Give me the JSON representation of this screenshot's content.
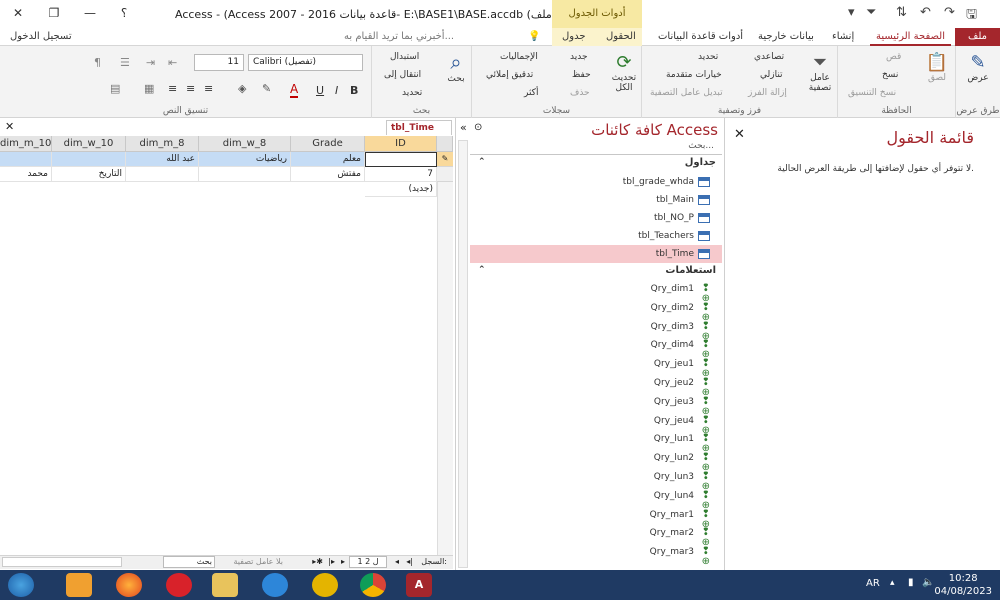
{
  "window": {
    "title": "Access - (Access 2007 - 2016 قاعدة بيانات- E:\\BASE1\\BASE.accdb (تنسيق ملف : BASE",
    "context_tools": "أدوات الجدول",
    "help": "؟",
    "min": "—",
    "restore": "❐",
    "close": "✕"
  },
  "tabs": {
    "file": "ملف",
    "home": "الصفحة الرئيسية",
    "create": "إنشاء",
    "external": "بيانات خارجية",
    "dbtools": "أدوات قاعدة البيانات",
    "fields": "الحقول",
    "table": "جدول",
    "tellme": "أخبرني بما تريد القيام به...",
    "signin": "تسجيل الدخول"
  },
  "ribbon": {
    "views": {
      "view": "عرض",
      "label": "طرق عرض"
    },
    "clipboard": {
      "paste": "لصق",
      "cut": "قص",
      "copy": "نسخ",
      "format_painter": "نسخ التنسيق",
      "label": "الحافظة"
    },
    "sort_filter": {
      "filter": "عامل تصفية",
      "ascending": "تصاعدي",
      "descending": "تنازلي",
      "remove_sort": "إزالة الفرز",
      "selection": "تحديد",
      "advanced": "خيارات متقدمة",
      "toggle_filter": "تبديل عامل التصفية",
      "label": "فرز وتصفية"
    },
    "records": {
      "refresh": "تحديث الكل",
      "new": "جديد",
      "save": "حفظ",
      "delete": "حذف",
      "totals": "الإجماليات",
      "spelling": "تدقيق إملائي",
      "more": "أكثر",
      "label": "سجلات"
    },
    "find": {
      "find": "بحث",
      "replace": "استبدال",
      "goto": "انتقال إلى",
      "select": "تحديد",
      "label": "بحث"
    },
    "text_format": {
      "font": "Calibri (تفصيل)",
      "size": "11",
      "bold": "B",
      "italic": "I",
      "underline": "U",
      "label": "تنسيق النص"
    }
  },
  "datasheet": {
    "tab_name": "tbl_Time",
    "columns": [
      "ID",
      "Grade",
      "dim_w_8",
      "dim_m_8",
      "dim_w_10",
      "dim_m_10"
    ],
    "rows": [
      [
        "",
        "معلم",
        "رياضيات",
        "عبد الله",
        "",
        ""
      ],
      [
        "7",
        "مفتش",
        "",
        "",
        "التاريخ",
        "محمد"
      ]
    ],
    "new_row": "(جديد)",
    "record_label": "السجل:",
    "record_pos": "1 ل 2",
    "no_filter": "بلا عامل تصفية",
    "search": "بحث"
  },
  "nav": {
    "title": "كافة كائنات Access",
    "search_placeholder": "بحث...",
    "groups": {
      "tables": "جداول",
      "queries": "استعلامات"
    },
    "tables": [
      "tbl_grade_whda",
      "tbl_Main",
      "tbl_NO_P",
      "tbl_Teachers",
      "tbl_Time"
    ],
    "queries": [
      "Qry_dim1",
      "Qry_dim2",
      "Qry_dim3",
      "Qry_dim4",
      "Qry_jeu1",
      "Qry_jeu2",
      "Qry_jeu3",
      "Qry_jeu4",
      "Qry_lun1",
      "Qry_lun2",
      "Qry_lun3",
      "Qry_lun4",
      "Qry_mar1",
      "Qry_mar2",
      "Qry_mar3"
    ]
  },
  "fieldlist": {
    "title": "قائمة الحقول",
    "message": "لا تتوفر أي حقول لإضافتها إلى طريقة العرض الحالية."
  },
  "taskbar": {
    "lang": "AR",
    "time": "10:28",
    "date": "04/08/2023"
  }
}
